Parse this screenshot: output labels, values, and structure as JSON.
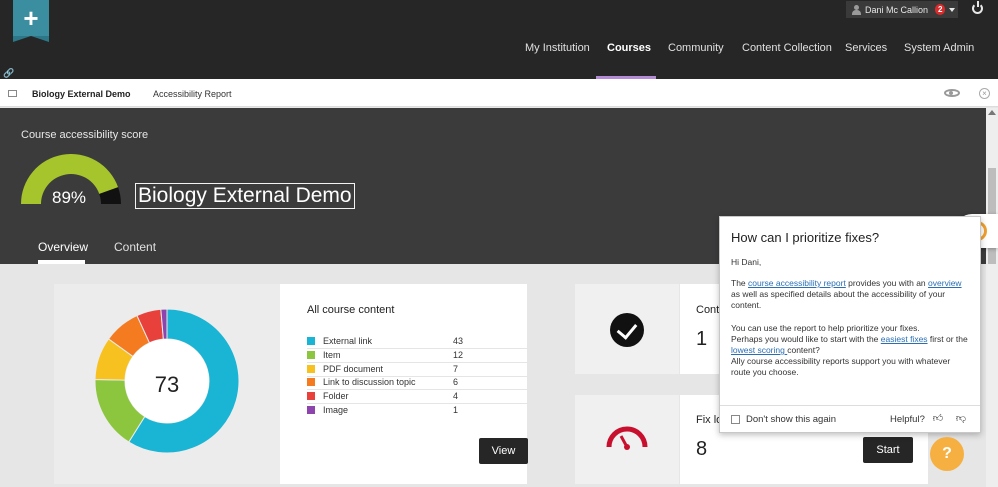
{
  "topbar": {
    "user_name": "Dani Mc Callion",
    "notification_count": "2",
    "nav": [
      "My Institution",
      "Courses",
      "Community",
      "Content Collection",
      "Services",
      "System Admin"
    ],
    "active_nav": "Courses"
  },
  "breadcrumb": {
    "course": "Biology External Demo",
    "page": "Accessibility Report"
  },
  "header": {
    "score_label": "Course accessibility score",
    "score_value": "89%",
    "score_fraction": 0.89,
    "course_title": "Biology External Demo",
    "tabs": [
      "Overview",
      "Content"
    ],
    "active_tab": "Overview"
  },
  "content_card": {
    "total": "73",
    "title": "All course content",
    "items": [
      {
        "label": "External link",
        "count": "43",
        "color": "#1ab4d4"
      },
      {
        "label": "Item",
        "count": "12",
        "color": "#8cc63f"
      },
      {
        "label": "PDF document",
        "count": "7",
        "color": "#f7c11f"
      },
      {
        "label": "Link to discussion topic",
        "count": "6",
        "color": "#f47b20"
      },
      {
        "label": "Folder",
        "count": "4",
        "color": "#e8413c"
      },
      {
        "label": "Image",
        "count": "1",
        "color": "#8e44ad"
      }
    ],
    "view_label": "View"
  },
  "stat_cards": {
    "card1_label": "Conte",
    "card1_value": "1",
    "card2_label": "Fix lo",
    "card2_value": "8",
    "start_label": "Start"
  },
  "popover": {
    "title": "How can I prioritize fixes?",
    "greeting": "Hi Dani,",
    "p1_pre": "The ",
    "p1_link1": "course accessibility report",
    "p1_mid": " provides you with an ",
    "p1_link2": "overview",
    "p1_post": " as well as specified details about the accessibility of your content.",
    "p2_line1": "You can use the report to help prioritize your fixes.",
    "p2_pre": "Perhaps you would like to start with the ",
    "p2_link1": "easiest fixes",
    "p2_mid": " first or the ",
    "p2_link2": "lowest scoring ",
    "p2_post": "content?",
    "p2_line4": "Ally course accessibility reports support you with whatever route you choose.",
    "dont_show": "Don't show this again",
    "helpful": "Helpful?"
  },
  "help": {
    "label": "?"
  },
  "colors": {
    "gauge_fill": "#a6c42b",
    "gauge_rest": "#111111",
    "fix_icon": "#c8102e"
  }
}
